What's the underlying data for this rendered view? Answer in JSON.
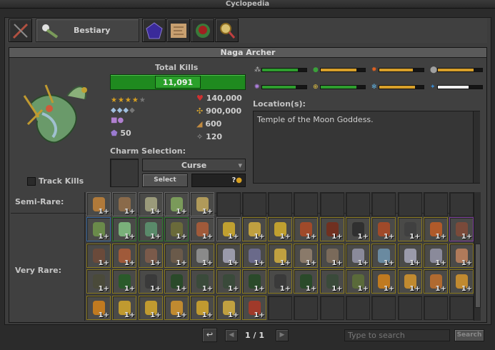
{
  "window": {
    "title": "Cyclopedia"
  },
  "tabs": [
    {
      "label": "",
      "icon": "weapons-icon"
    },
    {
      "label": "Bestiary",
      "icon": "bestiary-icon"
    },
    {
      "label": "",
      "icon": "charms-icon"
    },
    {
      "label": "",
      "icon": "map-icon"
    },
    {
      "label": "",
      "icon": "houses-icon"
    },
    {
      "label": "",
      "icon": "magnifier-icon"
    }
  ],
  "creature": {
    "name": "Naga Archer",
    "total_kills_label": "Total Kills",
    "total_kills": "11,091",
    "health": "140,000",
    "experience": "900,000",
    "speed": "600",
    "armor": "120",
    "charm_points": "50",
    "difficulty_stars": 4,
    "occurrence_diamonds": 3,
    "track_kills_label": "Track Kills"
  },
  "charm": {
    "label": "Charm Selection:",
    "selected": "Curse",
    "select_button": "Select",
    "price": "?"
  },
  "location": {
    "label": "Location(s):",
    "text": "Temple of the Moon Goddess."
  },
  "resistances": [
    {
      "icon": "physical-icon",
      "color": "#2e9e2e",
      "value": 0.8
    },
    {
      "icon": "earth-icon",
      "color": "#d8a02a",
      "value": 0.8
    },
    {
      "icon": "fire-icon",
      "color": "#d8a02a",
      "value": 0.75
    },
    {
      "icon": "death-icon",
      "color": "#d8a02a",
      "value": 0.8
    },
    {
      "icon": "energy-icon",
      "color": "#2e9e2e",
      "value": 0.75
    },
    {
      "icon": "holy-icon",
      "color": "#2e9e2e",
      "value": 0.8
    },
    {
      "icon": "ice-icon",
      "color": "#d8a02a",
      "value": 0.8
    },
    {
      "icon": "lifedrain-icon",
      "color": "#f0f0f0",
      "value": 0.7
    }
  ],
  "loot": {
    "semi_rare_label": "Semi-Rare:",
    "very_rare_label": "Very Rare:",
    "semi_rare": [
      {
        "q": "1+",
        "c": "#b07a3a",
        "f": "item"
      },
      {
        "q": "1+",
        "c": "#8a6a4a",
        "f": "item"
      },
      {
        "q": "1+",
        "c": "#9a9a7a",
        "f": "item"
      },
      {
        "q": "1+",
        "c": "#7a9a5a",
        "f": "item"
      },
      {
        "q": "1+",
        "c": "#b09a5a",
        "f": "item"
      }
    ],
    "very_rare": [
      {
        "q": "1+",
        "c": "#6a8a4a",
        "f": "b"
      },
      {
        "q": "1+",
        "c": "#7ab07a",
        "f": "g"
      },
      {
        "q": "1+",
        "c": "#5a8a6a",
        "f": "g"
      },
      {
        "q": "1+",
        "c": "#6a6a3a",
        "f": "g"
      },
      {
        "q": "1+",
        "c": "#a05a3a",
        "f": "item"
      },
      {
        "q": "1+",
        "c": "#c0a030",
        "f": "item"
      },
      {
        "q": "1+",
        "c": "#c0a040",
        "f": "y"
      },
      {
        "q": "1+",
        "c": "#c0a030",
        "f": "y"
      },
      {
        "q": "1+",
        "c": "#a04a2a",
        "f": "y"
      },
      {
        "q": "1+",
        "c": "#703020",
        "f": "y"
      },
      {
        "q": "1+",
        "c": "#303030",
        "f": "y"
      },
      {
        "q": "1+",
        "c": "#a04a2a",
        "f": "y"
      },
      {
        "q": "1+",
        "c": "#404040",
        "f": "y"
      },
      {
        "q": "1+",
        "c": "#b05a2a",
        "f": "y"
      },
      {
        "q": "1+",
        "c": "#7a4a3a",
        "f": "p"
      },
      {
        "q": "1+",
        "c": "#6a4a3a",
        "f": "y"
      },
      {
        "q": "1+",
        "c": "#a05a3a",
        "f": "y"
      },
      {
        "q": "1+",
        "c": "#7a5a4a",
        "f": "y"
      },
      {
        "q": "1+",
        "c": "#6a5a4a",
        "f": "y"
      },
      {
        "q": "1+",
        "c": "#8a8a8a",
        "f": "y"
      },
      {
        "q": "1+",
        "c": "#9a9aaa",
        "f": "y"
      },
      {
        "q": "1+",
        "c": "#6a6a8a",
        "f": "y"
      },
      {
        "q": "1+",
        "c": "#c0a040",
        "f": "y"
      },
      {
        "q": "1+",
        "c": "#8a7a6a",
        "f": "y"
      },
      {
        "q": "1+",
        "c": "#7a6a5a",
        "f": "y"
      },
      {
        "q": "1+",
        "c": "#8a8a9a",
        "f": "y"
      },
      {
        "q": "1+",
        "c": "#6a8aa0",
        "f": "y"
      },
      {
        "q": "1+",
        "c": "#9a9aaa",
        "f": "y"
      },
      {
        "q": "1+",
        "c": "#8a8a9a",
        "f": "y"
      },
      {
        "q": "1+",
        "c": "#b07a5a",
        "f": "y"
      },
      {
        "q": "1+",
        "c": "#4a4a3a",
        "f": "y"
      },
      {
        "q": "1+",
        "c": "#2a5a2a",
        "f": "y"
      },
      {
        "q": "1+",
        "c": "#3a3a3a",
        "f": "y"
      },
      {
        "q": "1+",
        "c": "#2a4a2a",
        "f": "y"
      },
      {
        "q": "1+",
        "c": "#3a4a3a",
        "f": "y"
      },
      {
        "q": "1+",
        "c": "#3a4a3a",
        "f": "y"
      },
      {
        "q": "1+",
        "c": "#2a4a2a",
        "f": "y"
      },
      {
        "q": "1+",
        "c": "#3a3a3a",
        "f": "y"
      },
      {
        "q": "1+",
        "c": "#2a4a2a",
        "f": "y"
      },
      {
        "q": "1+",
        "c": "#3a4a3a",
        "f": "y"
      },
      {
        "q": "1+",
        "c": "#5a6a3a",
        "f": "y"
      },
      {
        "q": "1+",
        "c": "#c07a20",
        "f": "y"
      },
      {
        "q": "1+",
        "c": "#c08a30",
        "f": "y"
      },
      {
        "q": "1+",
        "c": "#b06a30",
        "f": "y"
      },
      {
        "q": "1+",
        "c": "#c08a30",
        "f": "y"
      },
      {
        "q": "1+",
        "c": "#c07a20",
        "f": "y"
      },
      {
        "q": "1+",
        "c": "#c09a30",
        "f": "y"
      },
      {
        "q": "1+",
        "c": "#c09a30",
        "f": "y"
      },
      {
        "q": "1+",
        "c": "#c08a30",
        "f": "y"
      },
      {
        "q": "1+",
        "c": "#c09a30",
        "f": "y"
      },
      {
        "q": "1+",
        "c": "#c0a040",
        "f": "y"
      },
      {
        "q": "1+",
        "c": "#a03a2a",
        "f": "y"
      }
    ]
  },
  "pagination": {
    "page": "1 / 1"
  },
  "search": {
    "placeholder": "Type to search",
    "button": "Search"
  }
}
